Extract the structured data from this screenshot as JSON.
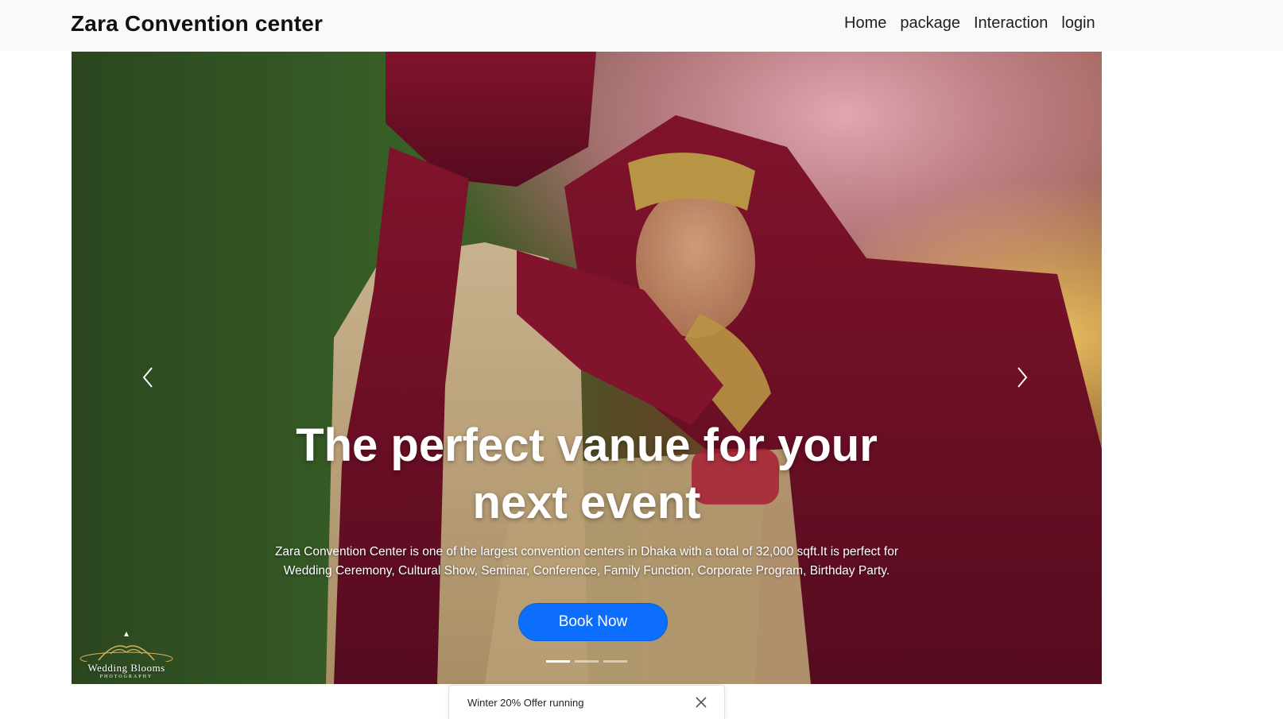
{
  "navbar": {
    "brand": "Zara Convention center",
    "links": [
      "Home",
      "package",
      "Interaction",
      "login"
    ]
  },
  "hero": {
    "headline_line1": "The perfect vanue for your",
    "headline_line2": "next event",
    "description_line1": "Zara Convention Center is one of the largest convention centers in Dhaka with a total of 32,000 sqft.It is perfect for",
    "description_line2": "Wedding Ceremony, Cultural Show, Seminar, Conference, Family Function, Corporate Program, Birthday Party.",
    "cta_label": "Book Now",
    "slide_count": 3,
    "active_slide": 1
  },
  "watermark": {
    "title": "Wedding Blooms",
    "subtitle": "PHOTOGRAPHY"
  },
  "toast": {
    "message": "Winter 20% Offer running"
  },
  "colors": {
    "navbar_bg": "#f8f9fa",
    "primary": "#0d6efd"
  },
  "icons": {
    "prev": "chevron-left-icon",
    "next": "chevron-right-icon",
    "close": "close-icon"
  }
}
